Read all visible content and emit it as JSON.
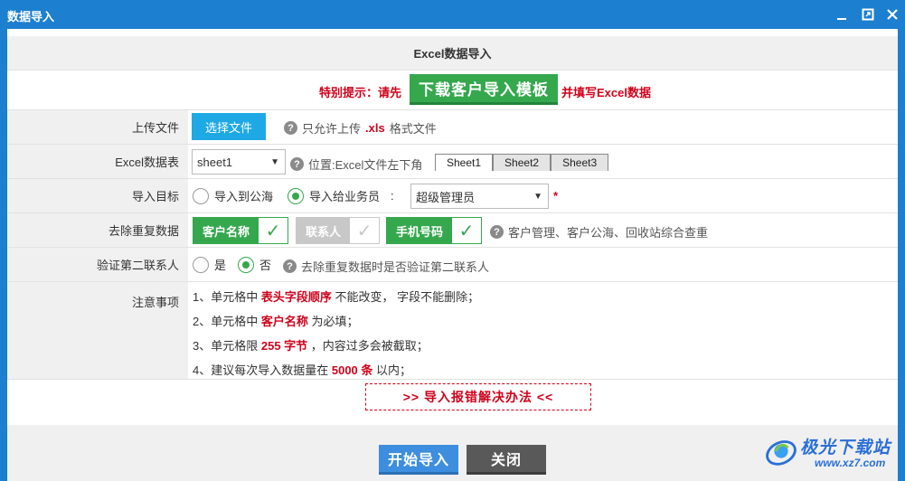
{
  "window": {
    "title": "数据导入",
    "controls": {
      "minimize_icon": "minimize-icon",
      "maximize_icon": "maximize-icon",
      "close_icon": "close-icon"
    }
  },
  "panel_header": "Excel数据导入",
  "tip": {
    "prefix": "特别提示：请先",
    "button": "下载客户导入模板",
    "suffix": "并填写Excel数据"
  },
  "upload": {
    "label": "上传文件",
    "button": "选择文件",
    "hint_pre": "只允许上传",
    "hint_ext": ".xls",
    "hint_post": "格式文件"
  },
  "excel_sheet": {
    "label": "Excel数据表",
    "selected": "sheet1",
    "hint": "位置:Excel文件左下角",
    "tabs": [
      "Sheet1",
      "Sheet2",
      "Sheet3"
    ],
    "active_tab": "Sheet1"
  },
  "target": {
    "label": "导入目标",
    "option1": "导入到公海",
    "option2": "导入给业务员",
    "colon": ":",
    "selected_option": "导入给业务员",
    "salesperson": "超级管理员",
    "required_mark": "*"
  },
  "dedupe": {
    "label": "去除重复数据",
    "items": [
      {
        "name": "客户名称",
        "checked": true
      },
      {
        "name": "联系人",
        "checked": false
      },
      {
        "name": "手机号码",
        "checked": true
      }
    ],
    "hint": "客户管理、客户公海、回收站综合查重"
  },
  "verify2": {
    "label": "验证第二联系人",
    "yes": "是",
    "no": "否",
    "selected": "否",
    "hint": "去除重复数据时是否验证第二联系人"
  },
  "notes": {
    "label": "注意事项",
    "lines": [
      {
        "pre": "1、单元格中",
        "em": "表头字段顺序",
        "post": "不能改变， 字段不能删除；"
      },
      {
        "pre": "2、单元格中",
        "em": "客户名称",
        "post": "为必填；"
      },
      {
        "pre": "3、单元格限",
        "em": "255 字节",
        "post": "，内容过多会被截取；"
      },
      {
        "pre": "4、建议每次导入数据量在",
        "em": "5000 条",
        "post": "以内；"
      }
    ]
  },
  "error_link": ">> 导入报错解决办法 <<",
  "footer": {
    "start": "开始导入",
    "close": "关闭"
  },
  "watermark": {
    "name": "极光下载站",
    "url": "www.xz7.com"
  },
  "colors": {
    "titlebar": "#1d7fcf",
    "green": "#35a84d",
    "red": "#d0021b",
    "blue_button": "#1fa9e4"
  }
}
